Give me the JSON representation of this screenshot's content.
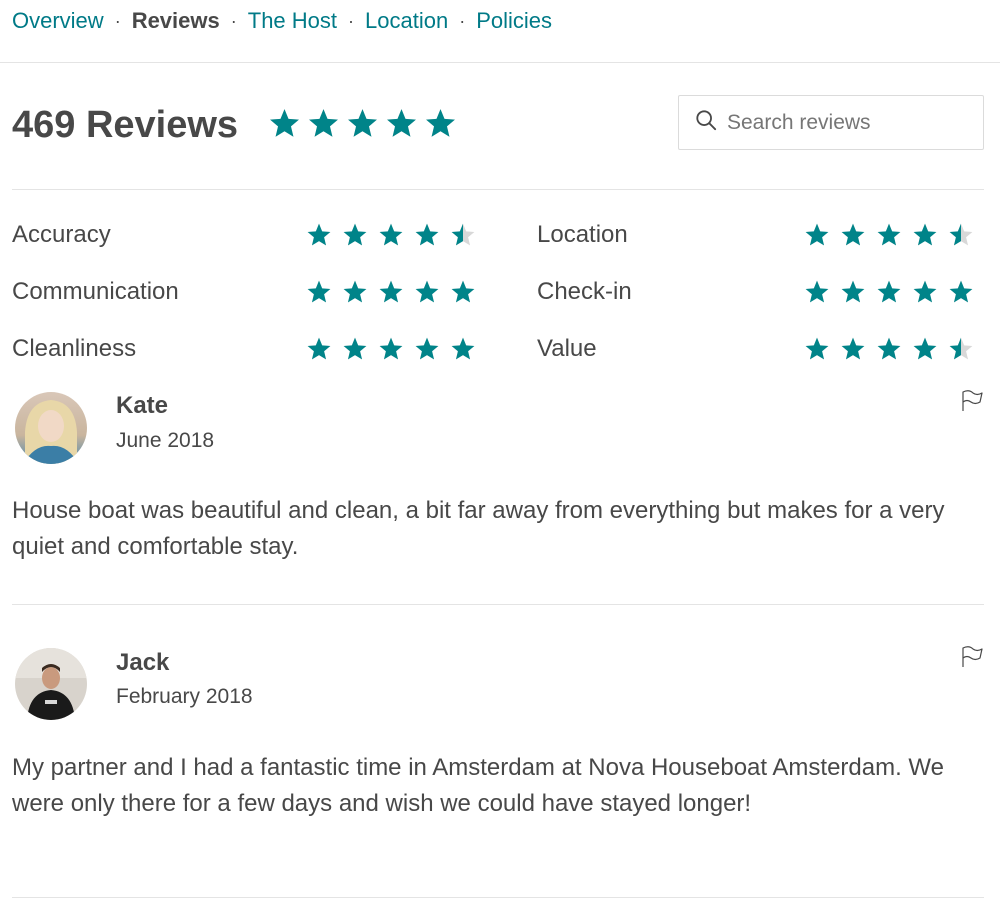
{
  "nav": {
    "items": [
      {
        "label": "Overview",
        "active": false
      },
      {
        "label": "Reviews",
        "active": true
      },
      {
        "label": "The Host",
        "active": false
      },
      {
        "label": "Location",
        "active": false
      },
      {
        "label": "Policies",
        "active": false
      }
    ],
    "separator": "·"
  },
  "header": {
    "title": "469 Reviews",
    "overall_rating": 5,
    "search_placeholder": "Search reviews"
  },
  "categories": [
    {
      "label": "Accuracy",
      "rating": 4.5
    },
    {
      "label": "Communication",
      "rating": 5
    },
    {
      "label": "Cleanliness",
      "rating": 5
    },
    {
      "label": "Location",
      "rating": 4.5
    },
    {
      "label": "Check-in",
      "rating": 5
    },
    {
      "label": "Value",
      "rating": 4.5
    }
  ],
  "reviews": [
    {
      "name": "Kate",
      "date": "June 2018",
      "text": "House boat was beautiful and clean, a bit far away from everything but makes for a very quiet and comfortable stay."
    },
    {
      "name": "Jack",
      "date": "February 2018",
      "text": "My partner and I had a fantastic time in Amsterdam at Nova Houseboat Amsterdam. We were only there for a few days and wish we could have stayed longer!"
    }
  ],
  "colors": {
    "accent": "#007a87",
    "star": "#008489",
    "star_empty": "#d8d8d8",
    "text": "#484848",
    "divider": "#e4e4e4"
  },
  "icons": {
    "search": "search-icon",
    "flag": "flag-icon",
    "star": "star-icon"
  }
}
